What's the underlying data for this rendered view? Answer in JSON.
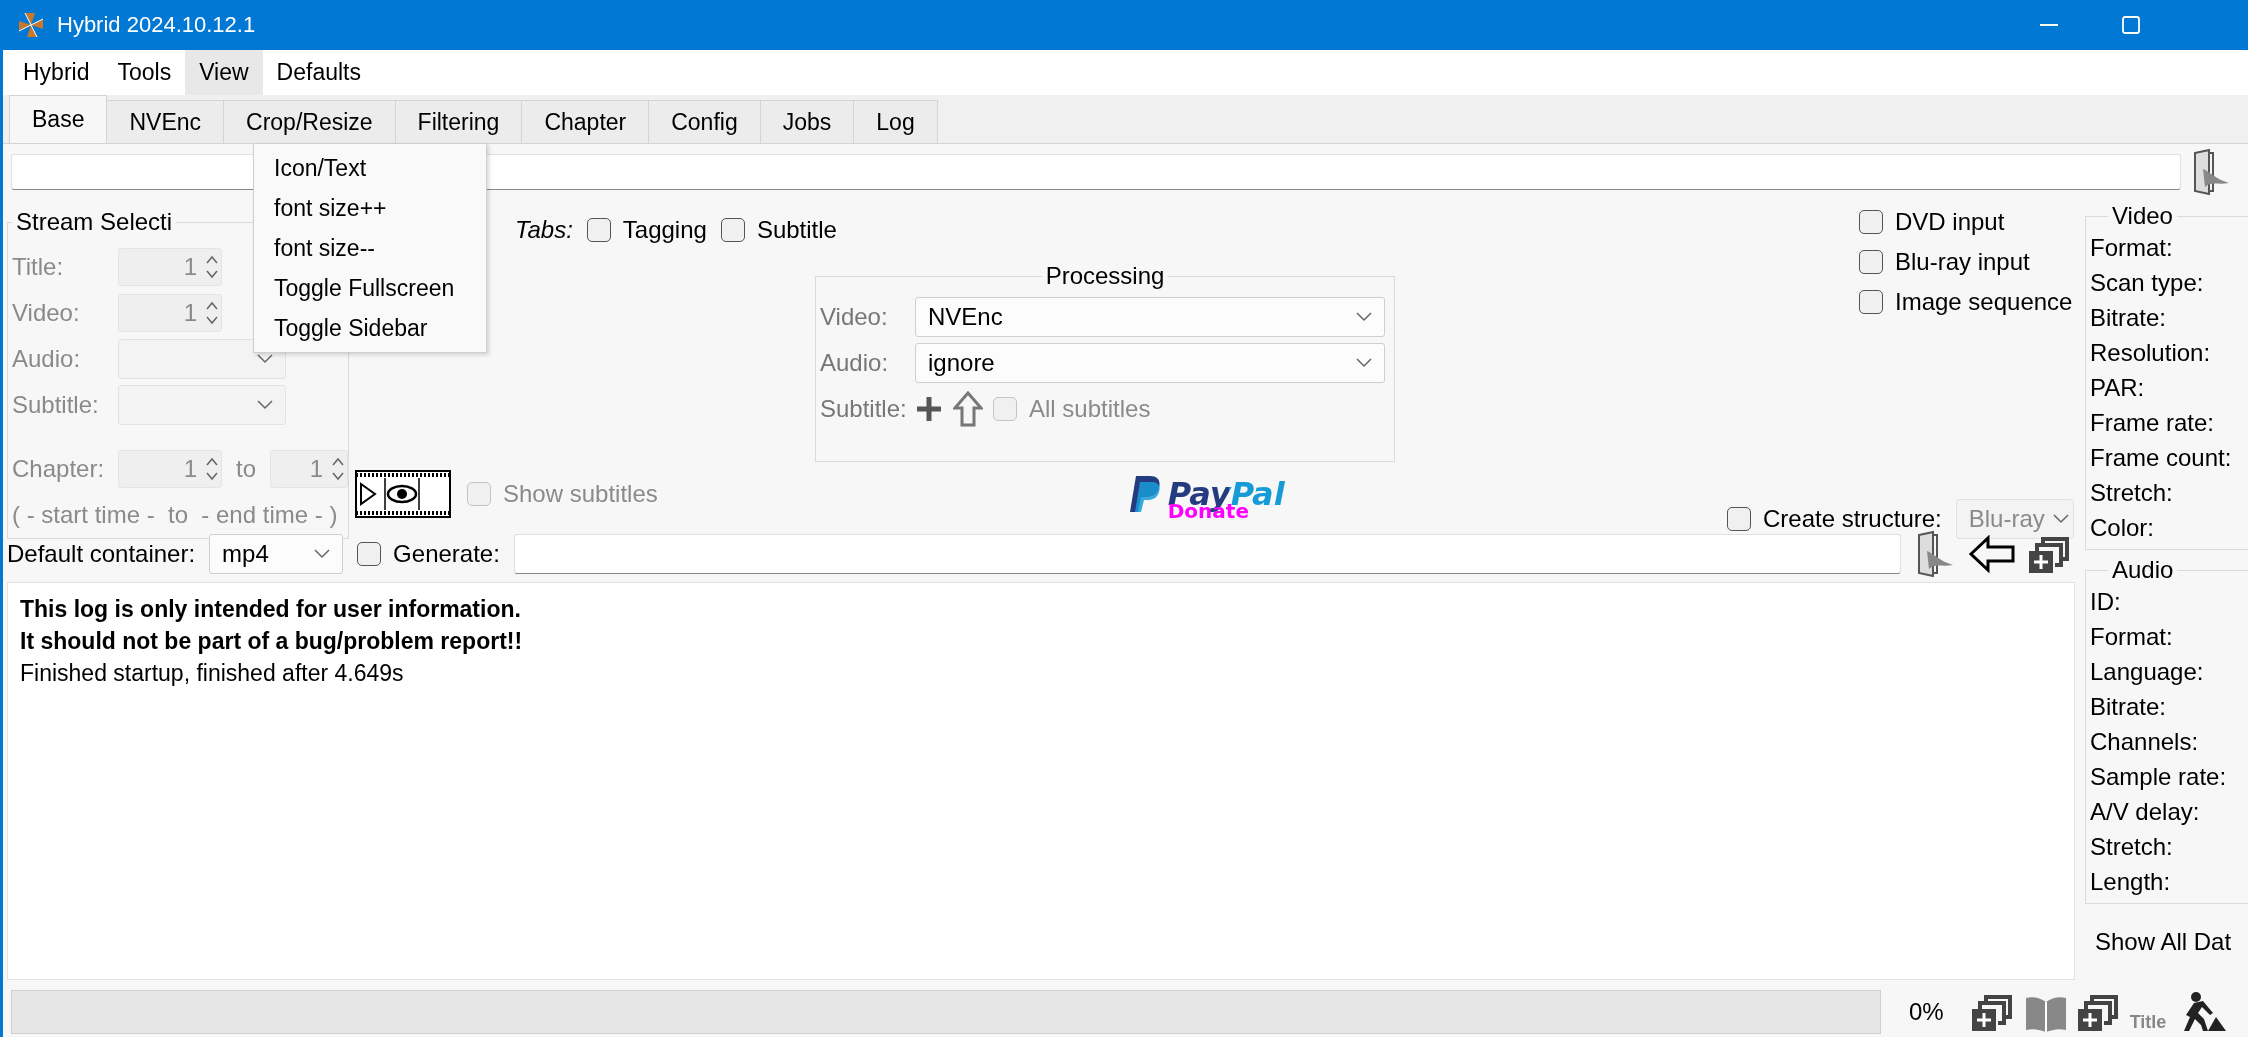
{
  "window": {
    "title": "Hybrid 2024.10.12.1"
  },
  "menu_bar": [
    {
      "label": "Hybrid",
      "selected": false
    },
    {
      "label": "Tools",
      "selected": false
    },
    {
      "label": "View",
      "selected": true
    },
    {
      "label": "Defaults",
      "selected": false
    }
  ],
  "view_menu": {
    "items": [
      "Icon/Text",
      "font size++",
      "font size--",
      "Toggle Fullscreen",
      "Toggle Sidebar"
    ]
  },
  "tabs": [
    {
      "label": "Base",
      "selected": true
    },
    {
      "label": "NVEnc",
      "selected": false
    },
    {
      "label": "Crop/Resize",
      "selected": false
    },
    {
      "label": "Filtering",
      "selected": false
    },
    {
      "label": "Chapter",
      "selected": false
    },
    {
      "label": "Config",
      "selected": false
    },
    {
      "label": "Jobs",
      "selected": false
    },
    {
      "label": "Log",
      "selected": false
    }
  ],
  "stream_selection": {
    "title": "Stream Selecti",
    "disabled": true,
    "rows": [
      {
        "label": "Title:",
        "kind": "spin",
        "value": "1"
      },
      {
        "label": "Video:",
        "kind": "spin",
        "value": "1"
      },
      {
        "label": "Audio:",
        "kind": "combo"
      },
      {
        "label": "Subtitle:",
        "kind": "combo"
      }
    ],
    "chapter": {
      "label": "Chapter:",
      "from": "1",
      "to_label": "to",
      "to": "1"
    },
    "time_range": "( - start time -  to  - end time - )"
  },
  "tabs_options": {
    "label": "Tabs:",
    "checkboxes": [
      {
        "label": "Tagging",
        "checked": false
      },
      {
        "label": "Subtitle",
        "checked": false
      }
    ]
  },
  "processing": {
    "title": "Processing",
    "video": {
      "label": "Video:",
      "value": "NVEnc"
    },
    "audio": {
      "label": "Audio:",
      "value": "ignore"
    },
    "subtitle": {
      "label": "Subtitle:",
      "all_subtitles": {
        "label": "All subtitles",
        "checked": false,
        "disabled": true
      }
    }
  },
  "show_subtitles": {
    "label": "Show subtitles",
    "checked": false,
    "disabled": true
  },
  "paypal": {
    "brand": "PayPal",
    "caption": "Donate"
  },
  "input_options": [
    {
      "label": "DVD input",
      "checked": false
    },
    {
      "label": "Blu-ray input",
      "checked": false
    },
    {
      "label": "Image sequence",
      "checked": false
    }
  ],
  "create_structure": {
    "label": "Create structure:",
    "checked": false,
    "value": "Blu-ray",
    "disabled": true
  },
  "default_container": {
    "label": "Default container:",
    "value": "mp4"
  },
  "generate": {
    "label": "Generate:",
    "checked": false
  },
  "log": {
    "lines": [
      {
        "text": "This log is only intended for user information.",
        "bold": true
      },
      {
        "text": "It should not be part of a bug/problem report!!",
        "bold": true
      },
      {
        "text": "Finished startup, finished after 4.649s",
        "bold": false
      }
    ]
  },
  "video_info": {
    "title": "Video",
    "fields": [
      "Format:",
      "Scan type:",
      "Bitrate:",
      "Resolution:",
      "PAR:",
      "Frame rate:",
      "Frame count:",
      "Stretch:",
      "Color:"
    ]
  },
  "audio_info": {
    "title": "Audio",
    "fields": [
      "ID:",
      "Format:",
      "Language:",
      "Bitrate:",
      "Channels:",
      "Sample rate:",
      "A/V delay:",
      "Stretch:",
      "Length:"
    ]
  },
  "show_all_data": "Show All Dat",
  "status_bar": {
    "progress": {
      "level": 0
    },
    "percent": "0%",
    "title_label": "Title"
  }
}
